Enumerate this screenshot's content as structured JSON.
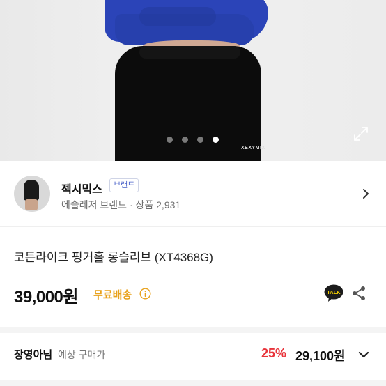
{
  "gallery": {
    "image_label": "product-photo",
    "watermark": "XEXYMIX",
    "slide_count": 4,
    "active_slide": 4
  },
  "brand": {
    "name": "젝시믹스",
    "badge": "브랜드",
    "subtitle": "에슬레저 브랜드 · 상품 2,931"
  },
  "product": {
    "title": "코튼라이크 핑거홀 롱슬리브 (XT4368G)",
    "price": "39,000원",
    "shipping": "무료배송"
  },
  "discount": {
    "label": "장영아님",
    "sublabel": "예상 구매가",
    "rate": "25%",
    "price": "29,100원"
  },
  "icons": {
    "expand": "expand-icon",
    "brand_chevron": "chevron-right-icon",
    "info": "info-icon",
    "talk": "kakaotalk-icon",
    "share": "share-icon",
    "dropdown": "chevron-down-icon"
  },
  "colors": {
    "brand_accent": "#4a62c9",
    "shipping": "#e8a11a",
    "discount": "#e8343b",
    "talk_bg": "#1c1c1c"
  }
}
